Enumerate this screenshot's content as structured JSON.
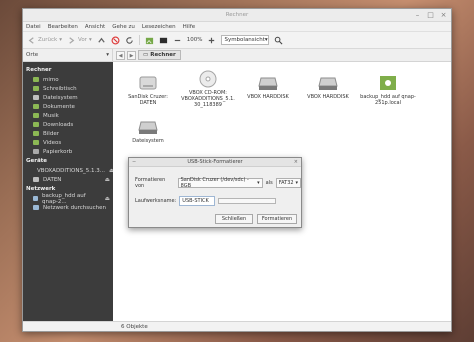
{
  "window": {
    "title": "Rechner"
  },
  "menu": [
    "Datei",
    "Bearbeiten",
    "Ansicht",
    "Gehe zu",
    "Lesezeichen",
    "Hilfe"
  ],
  "toolbar": {
    "back_label": "Zurück",
    "forward_label": "Vor",
    "zoom": "100%",
    "view_mode": "Symbolansicht"
  },
  "locationbar": {
    "places_label": "Orte",
    "crumb": "Rechner"
  },
  "sidebar": {
    "sections": [
      {
        "title": "Rechner",
        "items": [
          {
            "label": "mimo",
            "icon": "folder-icon"
          },
          {
            "label": "Schreibtisch",
            "icon": "folder-icon"
          },
          {
            "label": "Dateisystem",
            "icon": "drive-icon"
          },
          {
            "label": "Dokumente",
            "icon": "folder-icon"
          },
          {
            "label": "Musik",
            "icon": "folder-icon"
          },
          {
            "label": "Downloads",
            "icon": "folder-icon"
          },
          {
            "label": "Bilder",
            "icon": "folder-icon"
          },
          {
            "label": "Videos",
            "icon": "folder-icon"
          },
          {
            "label": "Papierkorb",
            "icon": "trash-icon"
          }
        ]
      },
      {
        "title": "Geräte",
        "items": [
          {
            "label": "VBOXADDITIONS_5.1.3...",
            "icon": "drive-icon",
            "eject": "⏏"
          },
          {
            "label": "DATEN",
            "icon": "drive-icon",
            "eject": "⏏"
          }
        ]
      },
      {
        "title": "Netzwerk",
        "items": [
          {
            "label": "backup_hdd auf qnap-2...",
            "icon": "network-icon",
            "eject": "⏏"
          },
          {
            "label": "Netzwerk durchsuchen",
            "icon": "network-icon"
          }
        ]
      }
    ]
  },
  "files": [
    {
      "label": "SanDisk Cruzer: DATEN",
      "icon": "usb-drive-icon"
    },
    {
      "label": "VBOX CD-ROM: VBOXADDITIONS_5.1. 30_118389",
      "icon": "cdrom-icon"
    },
    {
      "label": "VBOX HARDDISK",
      "icon": "harddisk-icon"
    },
    {
      "label": "VBOX HARDDISK",
      "icon": "harddisk-icon"
    },
    {
      "label": "backup_hdd auf qnap-251p.local",
      "icon": "network-share-icon"
    },
    {
      "label": "Dateisystem",
      "icon": "harddisk-icon"
    }
  ],
  "status": "6 Objekte",
  "dialog": {
    "title": "USB-Stick-Formatierer",
    "format_label": "Formatieren von",
    "device_value": "SanDisk Cruzer (/dev/sdc) - 8GB",
    "as_label": "als",
    "fs_value": "FAT32",
    "name_label": "Laufwerksname:",
    "name_value": "USB-STICK",
    "close_button": "Schließen",
    "format_button": "Formatieren"
  },
  "colors": {
    "sidebar_bg": "#3c3c3c",
    "folder_green": "#8cb854"
  }
}
